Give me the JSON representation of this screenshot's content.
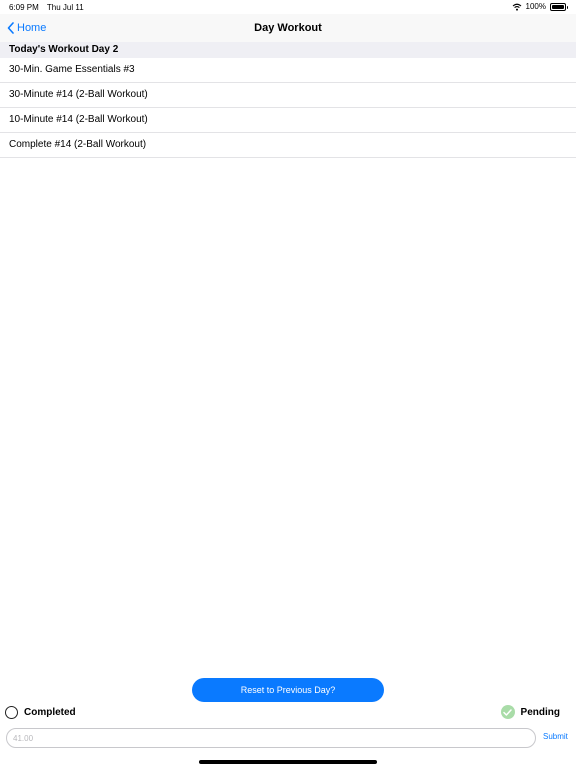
{
  "status_bar": {
    "time": "6:09 PM",
    "date": "Thu Jul 11",
    "battery": "100%"
  },
  "nav": {
    "back_label": "Home",
    "title": "Day Workout"
  },
  "section": {
    "title": "Today's Workout Day 2"
  },
  "workouts": [
    "30-Min. Game Essentials #3",
    "30-Minute #14 (2-Ball Workout)",
    "10-Minute #14 (2-Ball Workout)",
    "Complete #14 (2-Ball Workout)"
  ],
  "actions": {
    "reset_label": "Reset to Previous Day?",
    "submit_label": "Submit"
  },
  "status_options": {
    "completed_label": "Completed",
    "pending_label": "Pending",
    "selected": "Pending"
  },
  "entry": {
    "placeholder": "41.00",
    "value": ""
  },
  "colors": {
    "accent": "#0a7aff",
    "pending_check": "#a9dca8",
    "section_bg": "#efeff4"
  }
}
